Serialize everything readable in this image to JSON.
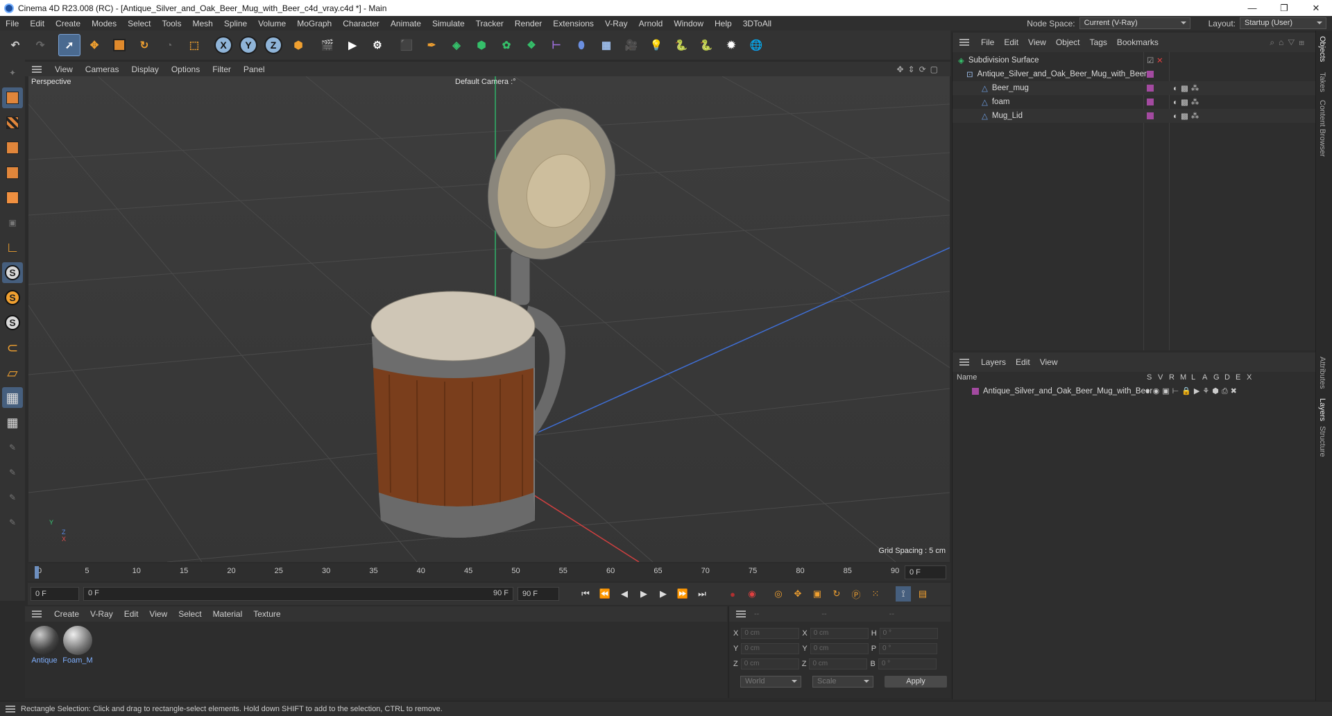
{
  "window": {
    "title": "Cinema 4D R23.008 (RC) - [Antique_Silver_and_Oak_Beer_Mug_with_Beer_c4d_vray.c4d *] - Main",
    "minimize": "—",
    "maximize": "❐",
    "close": "✕"
  },
  "menubar": {
    "items": [
      "File",
      "Edit",
      "Create",
      "Modes",
      "Select",
      "Tools",
      "Mesh",
      "Spline",
      "Volume",
      "MoGraph",
      "Character",
      "Animate",
      "Simulate",
      "Tracker",
      "Render",
      "Extensions",
      "V-Ray",
      "Arnold",
      "Window",
      "Help",
      "3DToAll"
    ],
    "node_space_label": "Node Space:",
    "node_space_value": "Current (V-Ray)",
    "layout_label": "Layout:",
    "layout_value": "Startup (User)"
  },
  "toolbar": {
    "axis_x": "X",
    "axis_y": "Y",
    "axis_z": "Z"
  },
  "viewport": {
    "menu": [
      "View",
      "Cameras",
      "Display",
      "Options",
      "Filter",
      "Panel"
    ],
    "view_name": "Perspective",
    "camera": "Default Camera",
    "camera_suffix": ":°",
    "grid_spacing": "Grid Spacing : 5 cm",
    "axis_y": "Y",
    "axis_z": "Z",
    "axis_x": "X"
  },
  "timeline": {
    "ticks": [
      "0",
      "5",
      "10",
      "15",
      "20",
      "25",
      "30",
      "35",
      "40",
      "45",
      "50",
      "55",
      "60",
      "65",
      "70",
      "75",
      "80",
      "85",
      "90"
    ],
    "current_frame_display": "0 F"
  },
  "controls": {
    "start_frame": "0 F",
    "range_start": "0 F",
    "range_end": "90 F",
    "end_frame": "90 F"
  },
  "material_manager": {
    "menu": [
      "Create",
      "V-Ray",
      "Edit",
      "View",
      "Select",
      "Material",
      "Texture"
    ],
    "materials": [
      "Antique",
      "Foam_M"
    ]
  },
  "coordinates": {
    "headers": [
      "--",
      "--",
      "--"
    ],
    "rows": [
      {
        "a": "X",
        "av": "0 cm",
        "b": "X",
        "bv": "0 cm",
        "c": "H",
        "cv": "0 °"
      },
      {
        "a": "Y",
        "av": "0 cm",
        "b": "Y",
        "bv": "0 cm",
        "c": "P",
        "cv": "0 °"
      },
      {
        "a": "Z",
        "av": "0 cm",
        "b": "Z",
        "bv": "0 cm",
        "c": "B",
        "cv": "0 °"
      }
    ],
    "space": "World",
    "mode": "Scale",
    "apply": "Apply"
  },
  "objects_panel": {
    "menu": [
      "File",
      "Edit",
      "View",
      "Object",
      "Tags",
      "Bookmarks"
    ],
    "items": [
      {
        "name": "Subdivision Surface",
        "level": 0
      },
      {
        "name": "Antique_Silver_and_Oak_Beer_Mug_with_Beer",
        "level": 1
      },
      {
        "name": "Beer_mug",
        "level": 2
      },
      {
        "name": "foam",
        "level": 2
      },
      {
        "name": "Mug_Lid",
        "level": 2
      }
    ]
  },
  "layers_panel": {
    "menu": [
      "Layers",
      "Edit",
      "View"
    ],
    "header_name": "Name",
    "header_flags": [
      "S",
      "V",
      "R",
      "M",
      "L",
      "A",
      "G",
      "D",
      "E",
      "X"
    ],
    "layer": "Antique_Silver_and_Oak_Beer_Mug_with_Beer"
  },
  "right_tabs": [
    "Objects",
    "Takes",
    "Content Browser",
    "Attributes",
    "Layers",
    "Structure"
  ],
  "status": "Rectangle Selection: Click and drag to rectangle-select elements. Hold down SHIFT to add to the selection, CTRL to remove."
}
